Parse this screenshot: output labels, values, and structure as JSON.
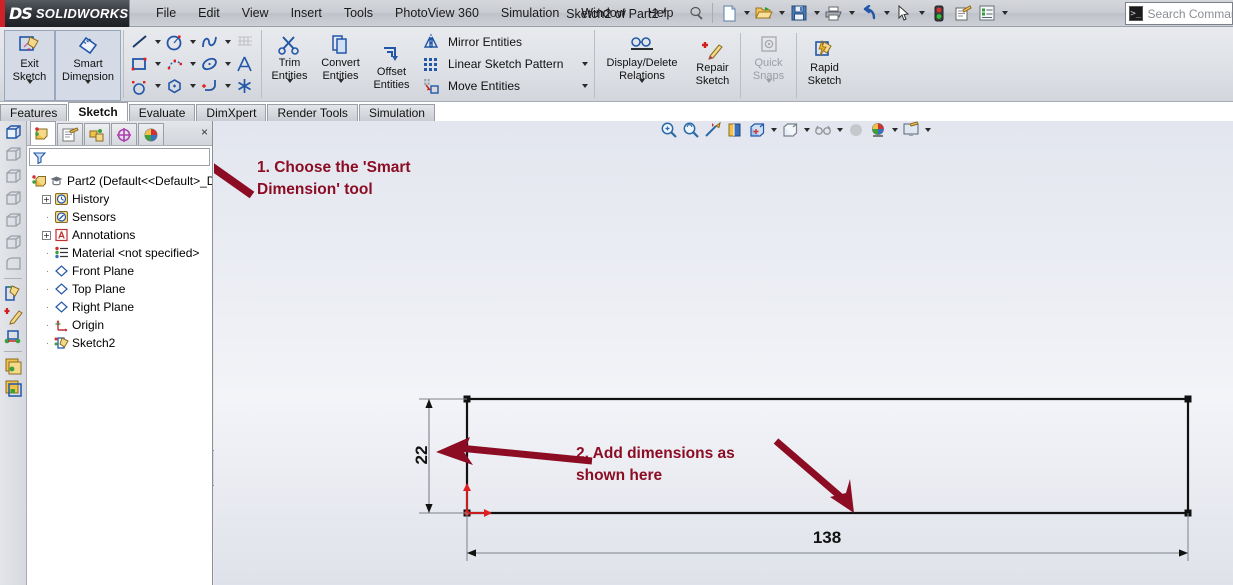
{
  "app": {
    "brand_3ds": "DS",
    "brand_name": "SOLIDWORKS",
    "document_title": "Sketch2 of Part2 *",
    "accent_color": "#8c0d23",
    "brand_red": "#cf2128"
  },
  "menubar": {
    "items": [
      "File",
      "Edit",
      "View",
      "Insert",
      "Tools",
      "PhotoView 360",
      "Simulation",
      "Window",
      "Help"
    ],
    "quick_access": [
      {
        "name": "new-document",
        "glyph": "page"
      },
      {
        "name": "open-document",
        "glyph": "folder"
      },
      {
        "name": "save",
        "glyph": "floppy"
      },
      {
        "name": "print",
        "glyph": "printer"
      },
      {
        "name": "undo",
        "glyph": "undo"
      },
      {
        "name": "select",
        "glyph": "cursor"
      },
      {
        "name": "rebuild",
        "glyph": "traffic"
      },
      {
        "name": "file-properties",
        "glyph": "props"
      },
      {
        "name": "options",
        "glyph": "options"
      }
    ]
  },
  "search": {
    "placeholder": "Search Commands",
    "icon": "search-console-icon"
  },
  "ribbon": {
    "buttons": [
      {
        "name": "exit-sketch",
        "label": "Exit\nSketch",
        "label_l1": "Exit",
        "label_l2": "Sketch",
        "has_dropdown": true,
        "selected": true,
        "disabled": false
      },
      {
        "name": "smart-dimension",
        "label_l1": "Smart",
        "label_l2": "Dimension",
        "has_dropdown": true,
        "selected": true,
        "disabled": false
      },
      {
        "name": "trim-entities",
        "label_l1": "Trim",
        "label_l2": "Entities",
        "has_dropdown": true,
        "selected": false,
        "disabled": false
      },
      {
        "name": "convert-entities",
        "label_l1": "Convert",
        "label_l2": "Entities",
        "has_dropdown": true,
        "selected": false,
        "disabled": false
      },
      {
        "name": "offset-entities",
        "label_l1": "Offset",
        "label_l2": "Entities",
        "has_dropdown": false,
        "selected": false,
        "disabled": false
      },
      {
        "name": "display-delete-relations",
        "label_l1": "Display/Delete",
        "label_l2": "Relations",
        "has_dropdown": true,
        "selected": false,
        "disabled": false
      },
      {
        "name": "repair-sketch",
        "label_l1": "Repair",
        "label_l2": "Sketch",
        "has_dropdown": false,
        "selected": false,
        "disabled": false
      },
      {
        "name": "quick-snaps",
        "label_l1": "Quick",
        "label_l2": "Snaps",
        "has_dropdown": true,
        "selected": false,
        "disabled": true
      },
      {
        "name": "rapid-sketch",
        "label_l1": "Rapid",
        "label_l2": "Sketch",
        "has_dropdown": false,
        "selected": false,
        "disabled": false
      }
    ],
    "sketch_tool_icons": [
      [
        "line",
        "circle",
        "spline",
        "surface-spline"
      ],
      [
        "rectangle",
        "polygon-points",
        "ellipse",
        "text"
      ],
      [
        "arc-slot",
        "polygon",
        "fillet",
        "point"
      ]
    ],
    "list_commands": [
      "Mirror Entities",
      "Linear Sketch Pattern",
      "Move Entities"
    ]
  },
  "tabs": {
    "items": [
      {
        "label": "Features",
        "active": false
      },
      {
        "label": "Sketch",
        "active": true
      },
      {
        "label": "Evaluate",
        "active": false
      },
      {
        "label": "DimXpert",
        "active": false
      },
      {
        "label": "Render Tools",
        "active": false
      },
      {
        "label": "Simulation",
        "active": false
      }
    ]
  },
  "tree_panel": {
    "tabs": [
      {
        "name": "feature-manager-tab",
        "active": true
      },
      {
        "name": "property-manager-tab",
        "active": false
      },
      {
        "name": "configuration-manager-tab",
        "active": false
      },
      {
        "name": "dimxpert-manager-tab",
        "active": false
      },
      {
        "name": "display-manager-tab",
        "active": false
      }
    ],
    "close_glyph": "×",
    "filter_placeholder": "",
    "items": [
      {
        "label": "Part2  (Default<<Default>_D",
        "icon": "part-icon",
        "expander": "none",
        "indent": 0
      },
      {
        "label": "History",
        "icon": "history-icon",
        "expander": "plus",
        "indent": 1
      },
      {
        "label": "Sensors",
        "icon": "sensors-icon",
        "expander": "dash",
        "indent": 1
      },
      {
        "label": "Annotations",
        "icon": "annotations-icon",
        "expander": "plus",
        "indent": 1
      },
      {
        "label": "Material <not specified>",
        "icon": "material-icon",
        "expander": "dash",
        "indent": 1
      },
      {
        "label": "Front Plane",
        "icon": "plane-icon",
        "expander": "dash",
        "indent": 1
      },
      {
        "label": "Top Plane",
        "icon": "plane-icon",
        "expander": "dash",
        "indent": 1
      },
      {
        "label": "Right Plane",
        "icon": "plane-icon",
        "expander": "dash",
        "indent": 1
      },
      {
        "label": "Origin",
        "icon": "origin-icon",
        "expander": "dash",
        "indent": 1
      },
      {
        "label": "Sketch2",
        "icon": "sketch-icon",
        "expander": "dash",
        "indent": 1
      }
    ]
  },
  "view_toolbar": {
    "items": [
      {
        "name": "zoom-to-fit-icon",
        "caret": false
      },
      {
        "name": "zoom-to-area-icon",
        "caret": false
      },
      {
        "name": "previous-view-icon",
        "caret": false
      },
      {
        "name": "section-view-icon",
        "caret": false
      },
      {
        "name": "view-orientation-icon",
        "caret": true
      },
      {
        "name": "display-style-icon",
        "caret": true
      },
      {
        "name": "hide-show-items-icon",
        "caret": true
      },
      {
        "name": "edit-appearance-icon",
        "caret": false
      },
      {
        "name": "apply-scene-icon",
        "caret": true
      },
      {
        "name": "view-settings-icon",
        "caret": true
      }
    ]
  },
  "annotations": [
    {
      "name": "annotation-step-1",
      "line1": "1. Choose the 'Smart",
      "line2": "Dimension' tool"
    },
    {
      "name": "annotation-step-2",
      "line1": "2. Add dimensions as",
      "line2": "shown here"
    }
  ],
  "sketch": {
    "name": "rectangle-sketch",
    "height_dimension": "22",
    "width_dimension": "138",
    "origin_label": "origin-marker"
  }
}
